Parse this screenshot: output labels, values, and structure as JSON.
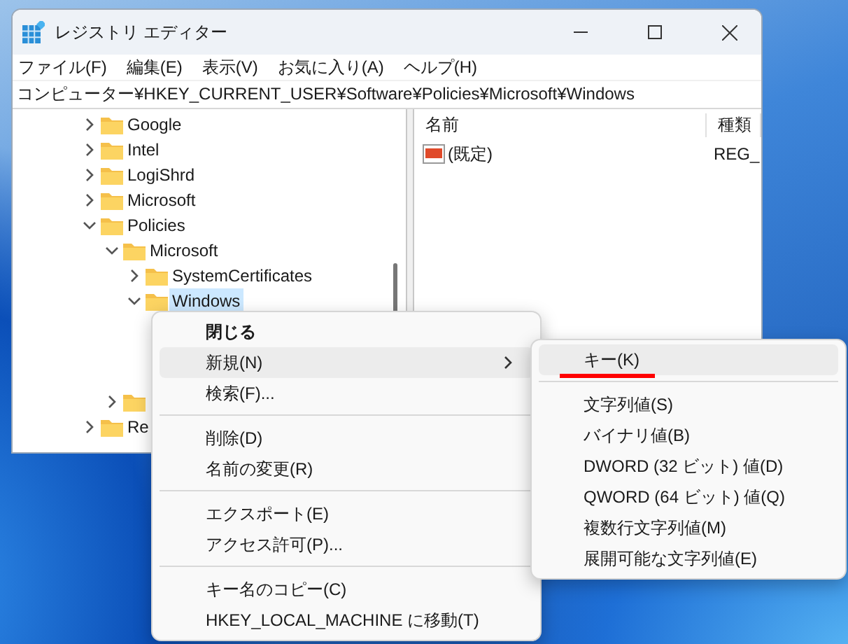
{
  "window": {
    "title": "レジストリ エディター"
  },
  "menu_bar": [
    "ファイル(F)",
    "編集(E)",
    "表示(V)",
    "お気に入り(A)",
    "ヘルプ(H)"
  ],
  "address": "コンピューター¥HKEY_CURRENT_USER¥Software¥Policies¥Microsoft¥Windows",
  "tree": [
    {
      "label": "Google",
      "expanded": false,
      "selected": false
    },
    {
      "label": "Intel",
      "expanded": false,
      "selected": false
    },
    {
      "label": "LogiShrd",
      "expanded": false,
      "selected": false
    },
    {
      "label": "Microsoft",
      "expanded": false,
      "selected": false
    },
    {
      "label": "Policies",
      "expanded": true,
      "selected": false,
      "children": [
        {
          "label": "Microsoft",
          "expanded": true,
          "selected": false,
          "children": [
            {
              "label": "SystemCertificates",
              "expanded": false,
              "selected": false
            },
            {
              "label": "Windows",
              "expanded": true,
              "selected": true
            }
          ]
        },
        {
          "expanded": false
        }
      ]
    },
    {
      "label": "Re",
      "expanded": false,
      "selected": false
    }
  ],
  "values_table": {
    "columns": [
      "名前",
      "種類"
    ],
    "rows": [
      {
        "name": "(既定)",
        "type": "REG_"
      }
    ]
  },
  "context_menu": [
    {
      "kind": "item",
      "label": "閉じる",
      "default": true,
      "selected": false,
      "submenu": false
    },
    {
      "kind": "item",
      "label": "新規(N)",
      "default": false,
      "selected": true,
      "submenu": true
    },
    {
      "kind": "item",
      "label": "検索(F)...",
      "default": false,
      "selected": false,
      "submenu": false
    },
    {
      "kind": "separator"
    },
    {
      "kind": "item",
      "label": "削除(D)",
      "default": false,
      "selected": false,
      "submenu": false
    },
    {
      "kind": "item",
      "label": "名前の変更(R)",
      "default": false,
      "selected": false,
      "submenu": false
    },
    {
      "kind": "separator"
    },
    {
      "kind": "item",
      "label": "エクスポート(E)",
      "default": false,
      "selected": false,
      "submenu": false
    },
    {
      "kind": "item",
      "label": "アクセス許可(P)...",
      "default": false,
      "selected": false,
      "submenu": false
    },
    {
      "kind": "separator"
    },
    {
      "kind": "item",
      "label": "キー名のコピー(C)",
      "default": false,
      "selected": false,
      "submenu": false
    },
    {
      "kind": "item",
      "label": "HKEY_LOCAL_MACHINE に移動(T)",
      "default": false,
      "selected": false,
      "submenu": false
    }
  ],
  "submenu": [
    {
      "kind": "item",
      "label": "キー(K)",
      "selected": true,
      "underlined": true
    },
    {
      "kind": "separator"
    },
    {
      "kind": "item",
      "label": "文字列値(S)",
      "selected": false,
      "underlined": false
    },
    {
      "kind": "item",
      "label": "バイナリ値(B)",
      "selected": false,
      "underlined": false
    },
    {
      "kind": "item",
      "label": "DWORD (32 ビット) 値(D)",
      "selected": false,
      "underlined": false
    },
    {
      "kind": "item",
      "label": "QWORD (64 ビット) 値(Q)",
      "selected": false,
      "underlined": false
    },
    {
      "kind": "item",
      "label": "複数行文字列値(M)",
      "selected": false,
      "underlined": false
    },
    {
      "kind": "item",
      "label": "展開可能な文字列値(E)",
      "selected": false,
      "underlined": false
    }
  ]
}
